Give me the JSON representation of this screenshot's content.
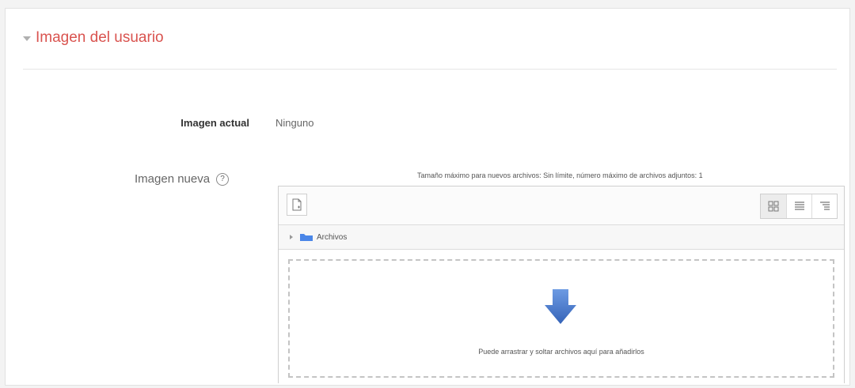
{
  "section": {
    "title": "Imagen del usuario"
  },
  "current_image": {
    "label": "Imagen actual",
    "value": "Ninguno"
  },
  "new_image": {
    "label": "Imagen nueva",
    "help_glyph": "?",
    "limits": "Tamaño máximo para nuevos archivos: Sin límite, número máximo de archivos adjuntos: 1",
    "path_folder": "Archivos",
    "drop_text": "Puede arrastrar y soltar archivos aquí para añadirlos"
  },
  "colors": {
    "accent": "#d9534f",
    "arrow": "#3d73c9",
    "folder": "#4a86e8"
  }
}
